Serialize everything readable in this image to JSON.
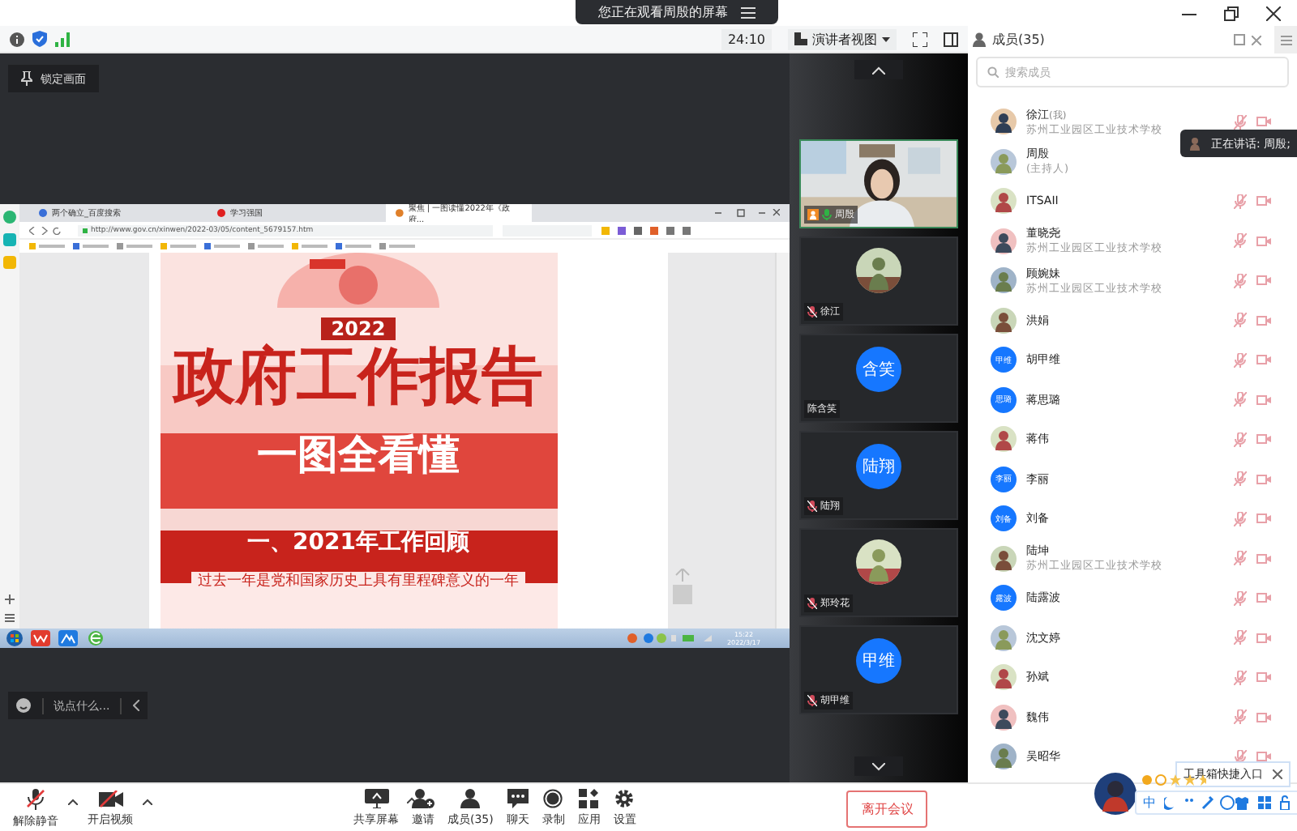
{
  "notice": {
    "text": "您正在观看周殷的屏幕"
  },
  "meeting_bar": {
    "timer": "24:10",
    "view_button": "演讲者视图"
  },
  "stage": {
    "lock_button": "锁定画面",
    "chat_placeholder": "说点什么..."
  },
  "shared_screen": {
    "tabs": [
      {
        "label": "两个确立_百度搜索",
        "selected": false
      },
      {
        "label": "学习强国",
        "selected": false
      },
      {
        "label": "聚焦 | 一图读懂2022年《政府...",
        "selected": true
      }
    ],
    "url": "http://www.gov.cn/xinwen/2022-03/05/content_5679157.htm",
    "poster": {
      "year": "2022",
      "title": "政府工作报告",
      "subtitle": "一图全看懂",
      "section": "一、2021年工作回顾",
      "lead": "过去一年是党和国家历史上具有里程碑意义的一年"
    },
    "taskbar": {
      "time": "15:22",
      "date": "2022/3/17"
    }
  },
  "video_tiles": [
    {
      "name": "周殷",
      "kind": "camera",
      "selected": true,
      "speaking": true,
      "muted": false
    },
    {
      "name": "徐江",
      "selected": false,
      "speaking": false,
      "muted": true
    },
    {
      "name": "陈含笑",
      "kind": "initials",
      "initials": "含笑",
      "selected": false,
      "speaking": false,
      "muted": false
    },
    {
      "name": "陆翔",
      "kind": "initials",
      "initials": "陆翔",
      "selected": false,
      "speaking": false,
      "muted": true
    },
    {
      "name": "郑玲花",
      "selected": false,
      "speaking": false,
      "muted": true
    },
    {
      "name": "胡甲维",
      "kind": "initials",
      "initials": "甲维",
      "selected": false,
      "speaking": false,
      "muted": true
    }
  ],
  "members": {
    "title": "成员(35)",
    "search_placeholder": "搜索成员",
    "list": [
      {
        "name": "徐江",
        "note": "(我)",
        "subtitle": "苏州工业园区工业技术学校",
        "muted": true,
        "camera_off": true
      },
      {
        "name": "周殷",
        "subtitle": "(主持人)",
        "muted": false,
        "camera_off": false
      },
      {
        "name": "ITSAII",
        "muted": true,
        "camera_off": true
      },
      {
        "name": "董晓尧",
        "subtitle": "苏州工业园区工业技术学校",
        "muted": true,
        "camera_off": true
      },
      {
        "name": "顾婉妹",
        "subtitle": "苏州工业园区工业技术学校",
        "muted": true,
        "camera_off": true
      },
      {
        "name": "洪娟",
        "muted": true,
        "camera_off": true
      },
      {
        "name": "胡甲维",
        "kind": "initials",
        "initials": "甲维",
        "muted": true,
        "camera_off": true
      },
      {
        "name": "蒋思璐",
        "kind": "initials",
        "initials": "思璐",
        "muted": true,
        "camera_off": true
      },
      {
        "name": "蒋伟",
        "muted": true,
        "camera_off": true
      },
      {
        "name": "李丽",
        "kind": "initials",
        "initials": "李丽",
        "muted": true,
        "camera_off": true
      },
      {
        "name": "刘备",
        "kind": "initials",
        "initials": "刘备",
        "muted": true,
        "camera_off": true
      },
      {
        "name": "陆坤",
        "subtitle": "苏州工业园区工业技术学校",
        "muted": true,
        "camera_off": true
      },
      {
        "name": "陆露波",
        "kind": "initials",
        "initials": "露波",
        "muted": true,
        "camera_off": true
      },
      {
        "name": "沈文婷",
        "muted": true,
        "camera_off": true
      },
      {
        "name": "孙斌",
        "muted": true,
        "camera_off": true
      },
      {
        "name": "魏伟",
        "muted": true,
        "camera_off": true
      },
      {
        "name": "吴昭华",
        "muted": true,
        "camera_off": true
      }
    ]
  },
  "speaking_tip": "正在讲话: 周殷;",
  "toolbox_tip": "工具箱快捷入口",
  "ime": {
    "mode": "中"
  },
  "toolbar": {
    "mic": "解除静音",
    "video": "开启视频",
    "items": [
      {
        "label": "共享屏幕",
        "kind": "share"
      },
      {
        "label": "邀请",
        "kind": "invite"
      },
      {
        "label": "成员(35)",
        "kind": "members"
      },
      {
        "label": "聊天",
        "kind": "chat"
      },
      {
        "label": "录制",
        "kind": "record"
      },
      {
        "label": "应用",
        "kind": "apps"
      },
      {
        "label": "设置",
        "kind": "settings"
      }
    ],
    "leave": "离开会议"
  }
}
